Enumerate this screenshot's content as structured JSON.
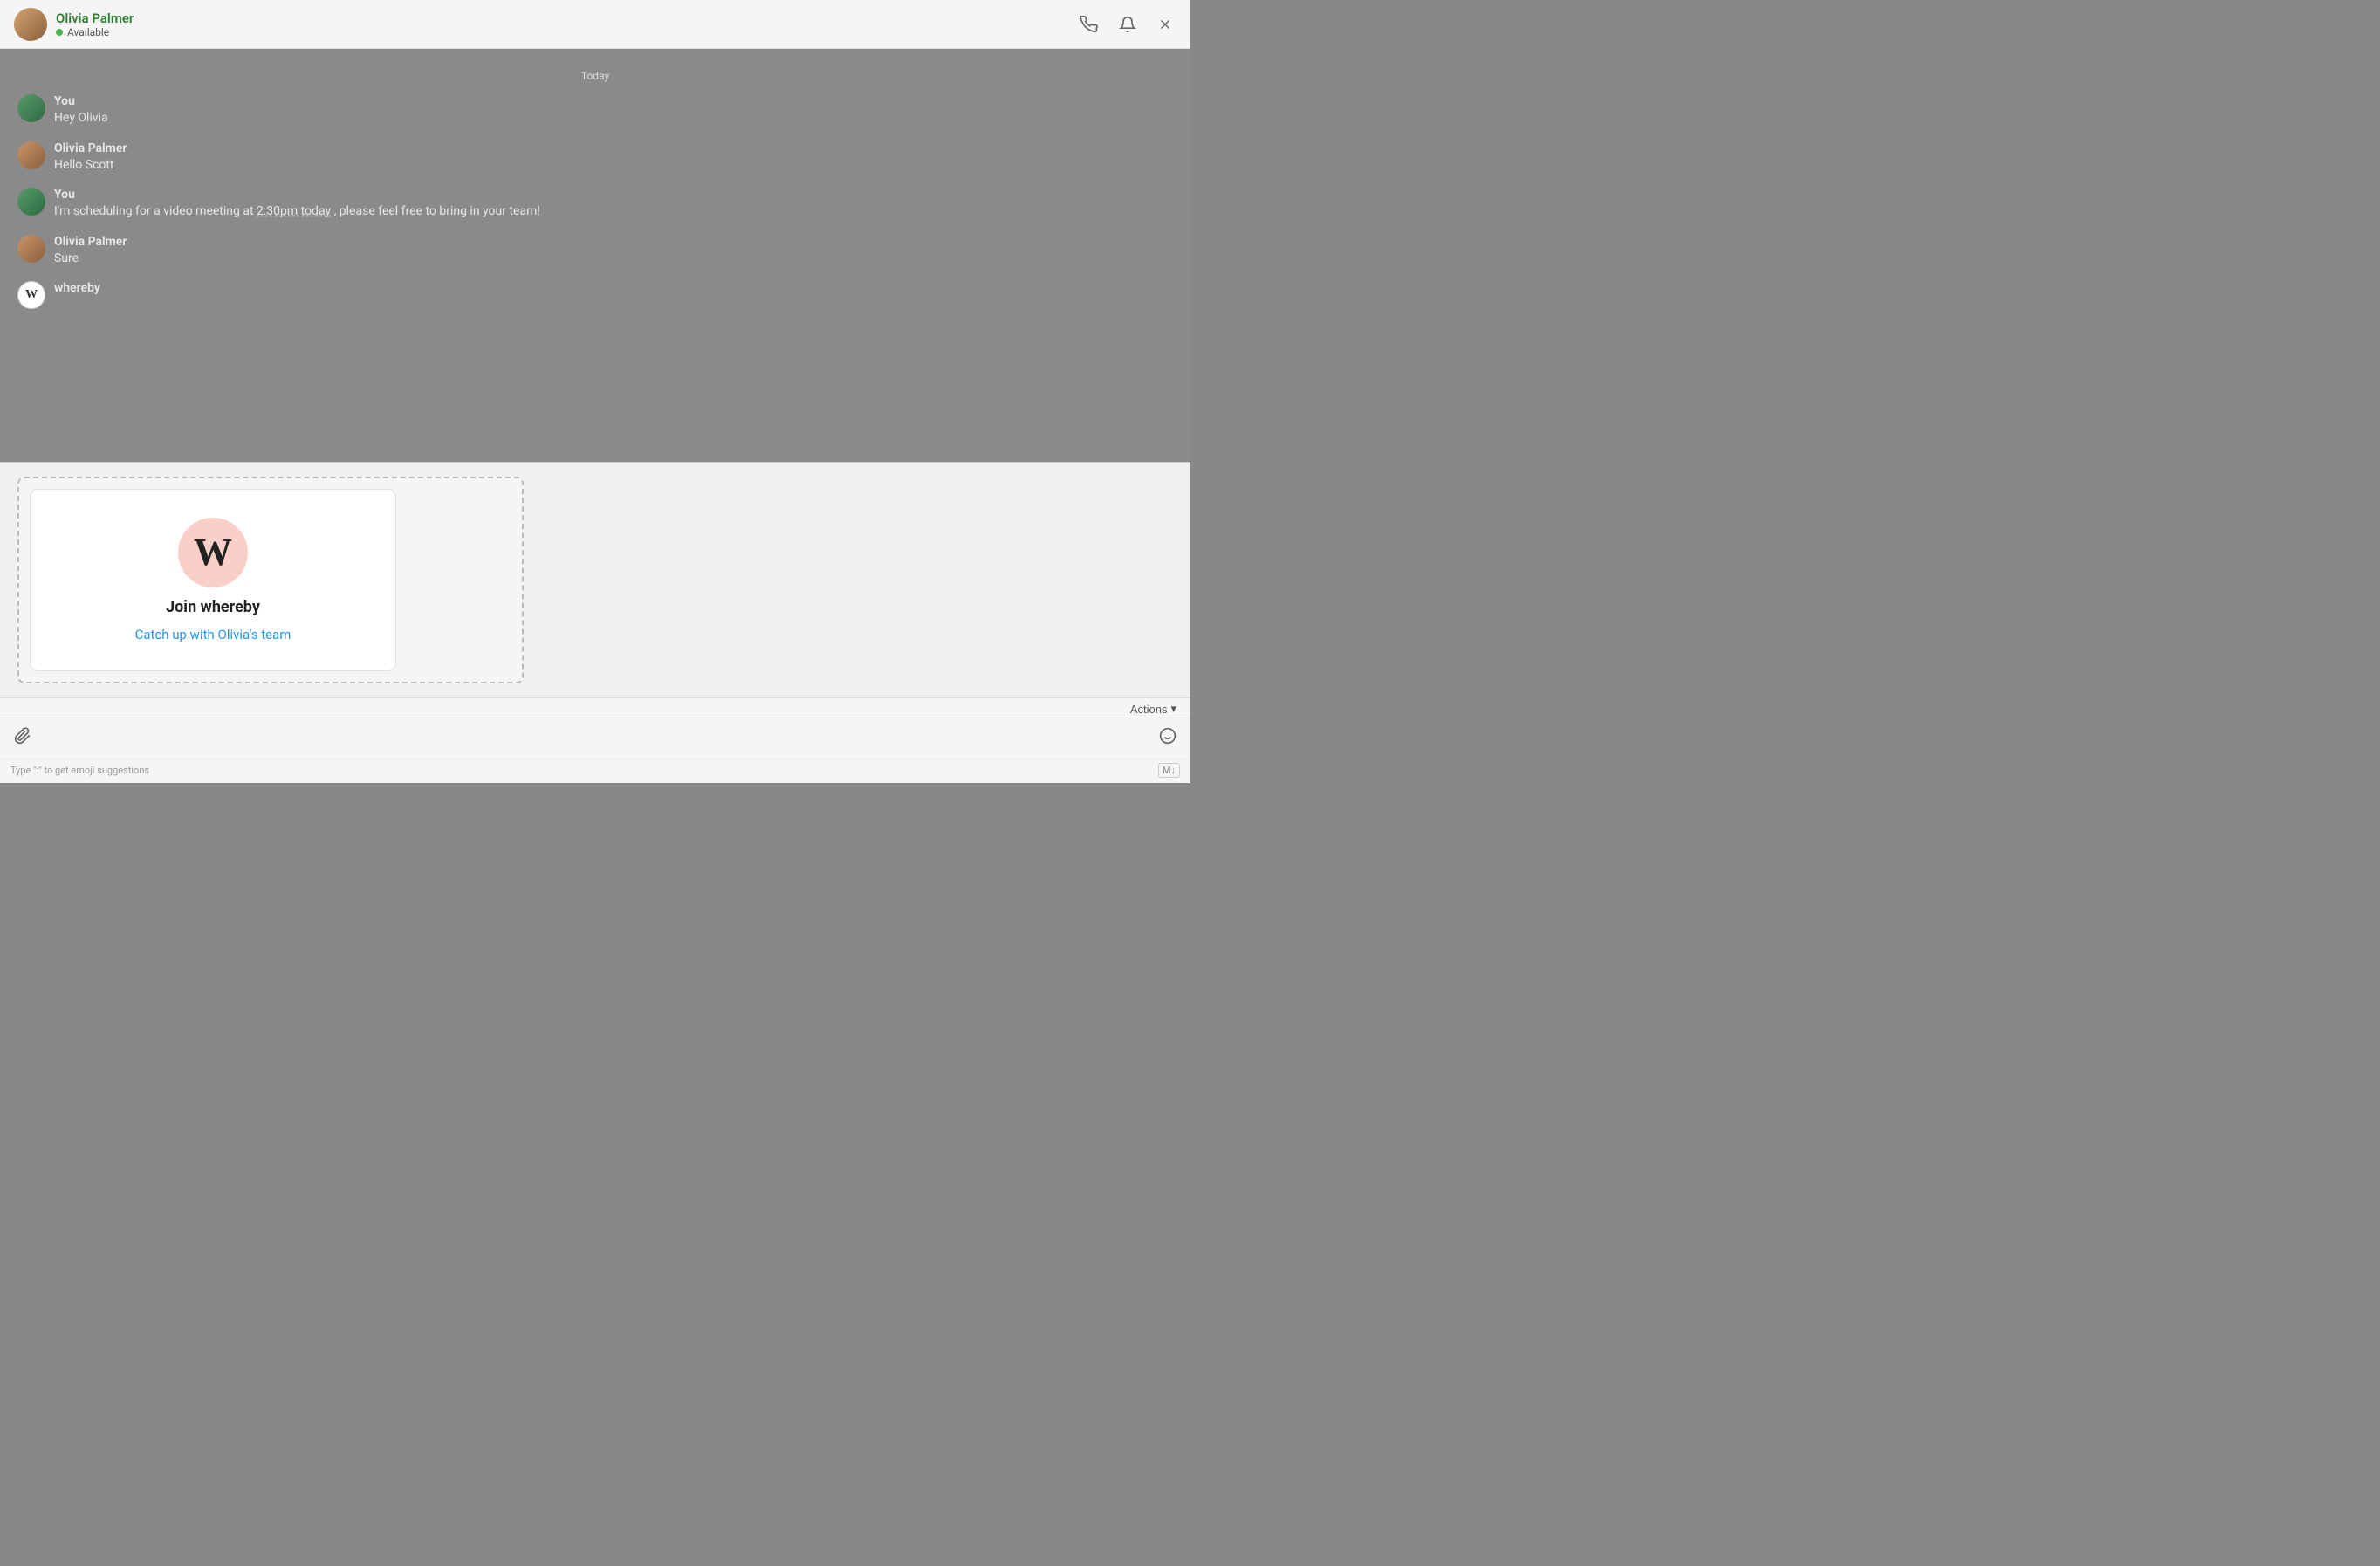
{
  "header": {
    "contact_name": "Olivia Palmer",
    "contact_status": "Available",
    "call_icon": "📞",
    "bell_icon": "🔔",
    "close_icon": "✕"
  },
  "date_divider": "Today",
  "messages": [
    {
      "id": "msg1",
      "sender": "You",
      "sender_type": "you",
      "text": "Hey Olivia"
    },
    {
      "id": "msg2",
      "sender": "Olivia  Palmer",
      "sender_type": "olivia",
      "text": "Hello Scott"
    },
    {
      "id": "msg3",
      "sender": "You",
      "sender_type": "you",
      "text_prefix": "I'm scheduling for a video meeting at ",
      "time_mention": "2:30pm today",
      "text_suffix": ", please feel free to bring in your team!"
    },
    {
      "id": "msg4",
      "sender": "Olivia  Palmer",
      "sender_type": "olivia",
      "text": "Sure"
    },
    {
      "id": "msg5",
      "sender": "whereby",
      "sender_type": "whereby",
      "text": ""
    }
  ],
  "whereby_card": {
    "title": "Join whereby",
    "link_text": "Catch up with Olivia's team"
  },
  "actions_label": "Actions",
  "input_placeholder": "",
  "hint_text": "Type \":\" to get emoji suggestions",
  "md_label": "M↓"
}
